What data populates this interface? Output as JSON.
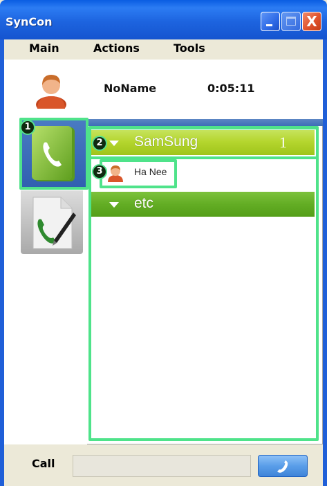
{
  "window": {
    "title": "SynCon"
  },
  "titlebar_buttons": {
    "minimize_icon": "minimize-icon",
    "maximize_icon": "maximize-icon",
    "close_icon": "close-icon",
    "close_glyph": "X"
  },
  "menu": {
    "items": [
      "Main",
      "Actions",
      "Tools"
    ]
  },
  "user": {
    "name": "NoName",
    "elapsed": "0:05:11",
    "avatar_icon": "person-icon"
  },
  "sidebar": {
    "tabs": [
      {
        "icon": "phonebook-icon",
        "selected": true
      },
      {
        "icon": "call-log-icon",
        "selected": false
      }
    ]
  },
  "groups": [
    {
      "name": "SamSung",
      "count": "1",
      "contacts": [
        {
          "name": "Ha Nee",
          "icon": "person-icon"
        }
      ]
    },
    {
      "name": "etc",
      "count": "",
      "contacts": []
    }
  ],
  "annotations": [
    "1",
    "2",
    "3"
  ],
  "callbar": {
    "label": "Call",
    "input_value": "",
    "button_icon": "phone-icon"
  },
  "colors": {
    "titlebar": "#1d64df",
    "highlight": "#4fe38a",
    "group_samsung": "#b5d62f",
    "group_etc": "#63ad24",
    "call_button": "#5a9ee9"
  }
}
